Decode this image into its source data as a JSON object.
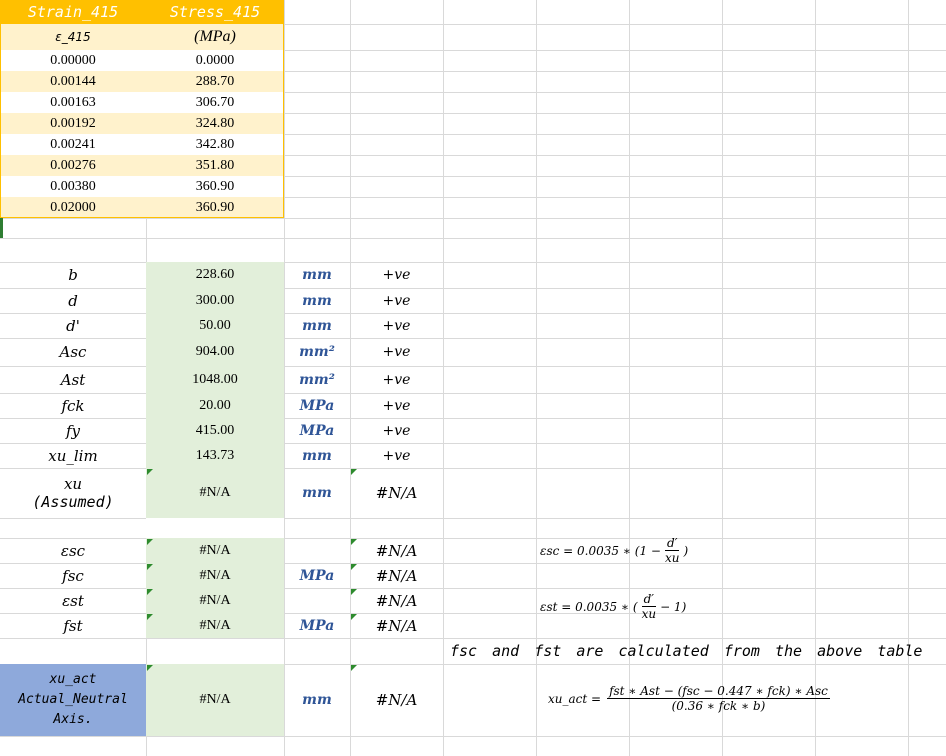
{
  "table_header": {
    "col1": "Strain_415",
    "col2": "Stress_415",
    "col1_sub": "ε_415",
    "col2_sub": "(MPa)"
  },
  "strain_stress_rows": [
    {
      "strain": "0.00000",
      "stress": "0.0000"
    },
    {
      "strain": "0.00144",
      "stress": "288.70"
    },
    {
      "strain": "0.00163",
      "stress": "306.70"
    },
    {
      "strain": "0.00192",
      "stress": "324.80"
    },
    {
      "strain": "0.00241",
      "stress": "342.80"
    },
    {
      "strain": "0.00276",
      "stress": "351.80"
    },
    {
      "strain": "0.00380",
      "stress": "360.90"
    },
    {
      "strain": "0.02000",
      "stress": "360.90"
    }
  ],
  "inputs": [
    {
      "label": "b",
      "value": "228.60",
      "unit": "mm",
      "sign": "+ve"
    },
    {
      "label": "d",
      "value": "300.00",
      "unit": "mm",
      "sign": "+ve"
    },
    {
      "label": "d'",
      "value": "50.00",
      "unit": "mm",
      "sign": "+ve"
    },
    {
      "label": "Asc",
      "value": "904.00",
      "unit": "mm²",
      "sign": "+ve"
    },
    {
      "label": "Ast",
      "value": "1048.00",
      "unit": "mm²",
      "sign": "+ve"
    },
    {
      "label": "fck",
      "value": "20.00",
      "unit": "MPa",
      "sign": "+ve"
    },
    {
      "label": "fy",
      "value": "415.00",
      "unit": "MPa",
      "sign": "+ve"
    },
    {
      "label": "xu_lim",
      "value": "143.73",
      "unit": "mm",
      "sign": "+ve"
    }
  ],
  "xu_assumed": {
    "label": "xu",
    "label2": "(Assumed)",
    "value": "#N/A",
    "unit": "mm",
    "check": "#N/A"
  },
  "results": [
    {
      "label": "εsc",
      "value": "#N/A",
      "unit": "",
      "check": "#N/A"
    },
    {
      "label": "fsc",
      "value": "#N/A",
      "unit": "MPa",
      "check": "#N/A"
    },
    {
      "label": "εst",
      "value": "#N/A",
      "unit": "",
      "check": "#N/A"
    },
    {
      "label": "fst",
      "value": "#N/A",
      "unit": "MPa",
      "check": "#N/A"
    }
  ],
  "actual_na": {
    "line1": "xu_act",
    "line2": "Actual_Neutral",
    "line3": "Axis.",
    "value": "#N/A",
    "unit": "mm",
    "check": "#N/A"
  },
  "formulas": {
    "esc_lhs": "εsc = 0.0035 ∗ (1 −",
    "esc_num": "d′",
    "esc_den": "xu",
    "esc_tail": ")",
    "est_lhs": "εst = 0.0035 ∗ (",
    "est_num": "d′",
    "est_den": "xu",
    "est_tail": "− 1)",
    "xu_lhs": "xu_act =",
    "xu_num": "fst ∗ Ast − (fsc − 0.447 ∗ fck) ∗ Asc",
    "xu_den": "(0.36 ∗ fck ∗ b)"
  },
  "note": "fsc and fst are calculated from the above table"
}
